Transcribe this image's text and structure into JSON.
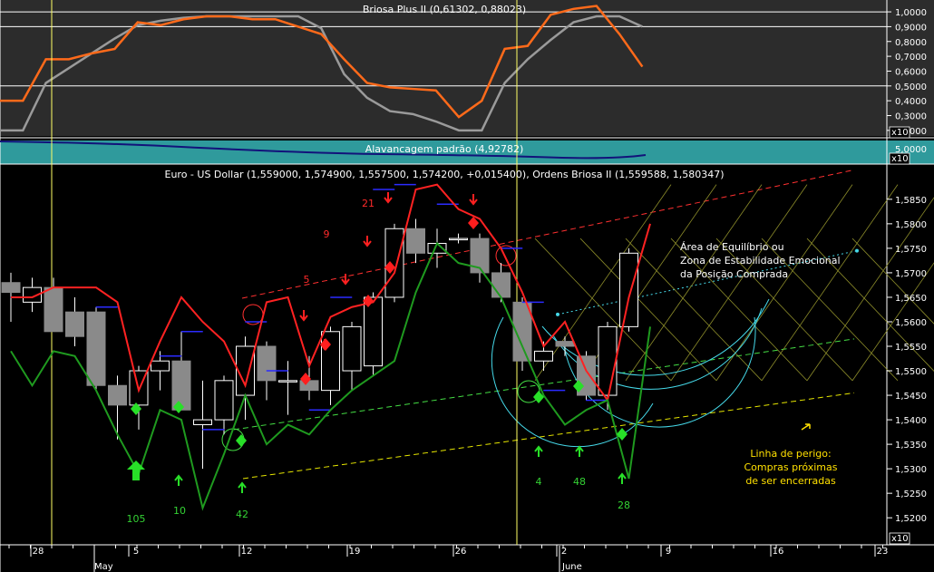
{
  "top_panel": {
    "title": "Briosa Plus II (0,61302, 0,88023)",
    "y_ticks": [
      "1,0000",
      "0,9000",
      "0,8000",
      "0,7000",
      "0,6000",
      "0,5000",
      "0,4000",
      "0,3000",
      "0,2000"
    ],
    "unit": "x10",
    "ref_lines": [
      0.5,
      0.9,
      1.0
    ],
    "series": [
      {
        "color": "#ff6a1a",
        "values": [
          0.4,
          0.4,
          0.68,
          0.68,
          0.72,
          0.75,
          0.93,
          0.91,
          0.95,
          0.97,
          0.97,
          0.95,
          0.95,
          0.9,
          0.85,
          0.68,
          0.52,
          0.49,
          0.48,
          0.47,
          0.29,
          0.4,
          0.75,
          0.77,
          0.98,
          1.02,
          1.04,
          0.85,
          0.63
        ]
      },
      {
        "color": "#9a9a9a",
        "values": [
          0.2,
          0.2,
          0.52,
          0.62,
          0.72,
          0.82,
          0.91,
          0.94,
          0.96,
          0.97,
          0.97,
          0.97,
          0.97,
          0.97,
          0.89,
          0.58,
          0.42,
          0.33,
          0.31,
          0.26,
          0.2,
          0.2,
          0.52,
          0.68,
          0.81,
          0.93,
          0.97,
          0.97,
          0.9
        ]
      }
    ]
  },
  "mid_panel": {
    "title": "Alavancagem padrão (4,92782)",
    "y_tick": "5,0000",
    "unit": "x10",
    "bg_color": "#2f9a9c"
  },
  "main_panel": {
    "title": "Euro - US Dollar (1,559000, 1,574900, 1,557500, 1,574200, +0,015400), Ordens Briosa II (1,559588, 1,580347)",
    "unit": "x10",
    "y_ticks": [
      "1,5850",
      "1,5800",
      "1,5750",
      "1,5700",
      "1,5650",
      "1,5600",
      "1,5550",
      "1,5500",
      "1,5450",
      "1,5400",
      "1,5350",
      "1,5300",
      "1,5250",
      "1,5200"
    ],
    "x_ticks": [
      "28",
      "5",
      "12",
      "19",
      "26",
      "2",
      "9",
      "16",
      "23"
    ],
    "month_labels": [
      "May",
      "June"
    ],
    "number_labels": [
      {
        "text": "21",
        "color": "#ff2a2a"
      },
      {
        "text": "9",
        "color": "#ff2a2a"
      },
      {
        "text": "5",
        "color": "#ff2a2a"
      },
      {
        "text": "105",
        "color": "#34d234"
      },
      {
        "text": "10",
        "color": "#34d234"
      },
      {
        "text": "42",
        "color": "#34d234"
      },
      {
        "text": "4",
        "color": "#34d234"
      },
      {
        "text": "48",
        "color": "#34d234"
      },
      {
        "text": "28",
        "color": "#34d234"
      }
    ],
    "annotations": {
      "equilibrium": [
        "Área de Equilíbrio ou",
        "Zona de Estabilidade Emocional",
        "da Posição Comprada"
      ],
      "danger": [
        "Linha de perigo:",
        "Compras próximas",
        "de ser encerradas"
      ]
    }
  },
  "chart_data": [
    {
      "type": "line",
      "title": "Briosa Plus II (0,61302, 0,88023)",
      "series": [
        {
          "values": [
            0.4,
            0.4,
            0.68,
            0.68,
            0.72,
            0.75,
            0.93,
            0.91,
            0.95,
            0.97,
            0.97,
            0.95,
            0.95,
            0.9,
            0.85,
            0.68,
            0.52,
            0.49,
            0.48,
            0.47,
            0.29,
            0.4,
            0.75,
            0.77,
            0.98,
            1.02,
            1.04,
            0.85,
            0.63
          ]
        },
        {
          "values": [
            0.2,
            0.2,
            0.52,
            0.62,
            0.72,
            0.82,
            0.91,
            0.94,
            0.96,
            0.97,
            0.97,
            0.97,
            0.97,
            0.97,
            0.89,
            0.58,
            0.42,
            0.33,
            0.31,
            0.26,
            0.2,
            0.2,
            0.52,
            0.68,
            0.81,
            0.93,
            0.97,
            0.97,
            0.9
          ]
        }
      ],
      "ylim": [
        0.15,
        1.08
      ],
      "grid": false
    },
    {
      "type": "candlestick",
      "title": "Euro - US Dollar (1,559000, 1,574900, 1,557500, 1,574200, +0,015400), Ordens Briosa II (1,559588, 1,580347)",
      "ylim": [
        1.518,
        1.592
      ],
      "x_ticks": [
        "28",
        "5",
        "12",
        "19",
        "26",
        "2",
        "9",
        "16",
        "23"
      ],
      "candles": [
        {
          "o": 1.568,
          "h": 1.57,
          "l": 1.56,
          "c": 1.566
        },
        {
          "o": 1.564,
          "h": 1.569,
          "l": 1.562,
          "c": 1.567
        },
        {
          "o": 1.567,
          "h": 1.569,
          "l": 1.558,
          "c": 1.558
        },
        {
          "o": 1.562,
          "h": 1.565,
          "l": 1.555,
          "c": 1.557
        },
        {
          "o": 1.562,
          "h": 1.563,
          "l": 1.546,
          "c": 1.547
        },
        {
          "o": 1.547,
          "h": 1.549,
          "l": 1.536,
          "c": 1.543
        },
        {
          "o": 1.543,
          "h": 1.551,
          "l": 1.538,
          "c": 1.55
        },
        {
          "o": 1.55,
          "h": 1.554,
          "l": 1.546,
          "c": 1.552
        },
        {
          "o": 1.552,
          "h": 1.558,
          "l": 1.544,
          "c": 1.542
        },
        {
          "o": 1.539,
          "h": 1.548,
          "l": 1.53,
          "c": 1.54
        },
        {
          "o": 1.54,
          "h": 1.549,
          "l": 1.537,
          "c": 1.548
        },
        {
          "o": 1.545,
          "h": 1.557,
          "l": 1.54,
          "c": 1.555
        },
        {
          "o": 1.555,
          "h": 1.556,
          "l": 1.544,
          "c": 1.548
        },
        {
          "o": 1.548,
          "h": 1.552,
          "l": 1.541,
          "c": 1.548
        },
        {
          "o": 1.548,
          "h": 1.553,
          "l": 1.544,
          "c": 1.546
        },
        {
          "o": 1.546,
          "h": 1.559,
          "l": 1.543,
          "c": 1.558
        },
        {
          "o": 1.55,
          "h": 1.56,
          "l": 1.546,
          "c": 1.559
        },
        {
          "o": 1.551,
          "h": 1.566,
          "l": 1.549,
          "c": 1.565
        },
        {
          "o": 1.565,
          "h": 1.58,
          "l": 1.564,
          "c": 1.579
        },
        {
          "o": 1.579,
          "h": 1.581,
          "l": 1.572,
          "c": 1.574
        },
        {
          "o": 1.574,
          "h": 1.579,
          "l": 1.571,
          "c": 1.576
        },
        {
          "o": 1.577,
          "h": 1.578,
          "l": 1.576,
          "c": 1.577
        },
        {
          "o": 1.577,
          "h": 1.578,
          "l": 1.568,
          "c": 1.57
        },
        {
          "o": 1.57,
          "h": 1.572,
          "l": 1.564,
          "c": 1.565
        },
        {
          "o": 1.564,
          "h": 1.565,
          "l": 1.55,
          "c": 1.552
        },
        {
          "o": 1.552,
          "h": 1.556,
          "l": 1.55,
          "c": 1.554
        },
        {
          "o": 1.556,
          "h": 1.557,
          "l": 1.553,
          "c": 1.555
        },
        {
          "o": 1.553,
          "h": 1.554,
          "l": 1.544,
          "c": 1.545
        },
        {
          "o": 1.545,
          "h": 1.56,
          "l": 1.542,
          "c": 1.559
        },
        {
          "o": 1.559,
          "h": 1.575,
          "l": 1.558,
          "c": 1.574
        }
      ],
      "series": [
        {
          "color": "#ff2222",
          "values": [
            1.565,
            1.565,
            1.567,
            1.567,
            1.567,
            1.564,
            1.546,
            1.556,
            1.565,
            1.56,
            1.556,
            1.547,
            1.564,
            1.565,
            1.551,
            1.561,
            1.563,
            1.564,
            1.57,
            1.587,
            1.588,
            1.583,
            1.581,
            1.575,
            1.566,
            1.555,
            1.56,
            1.55,
            1.544,
            1.565,
            1.58
          ]
        },
        {
          "color": "#1f9a1f",
          "values": [
            1.554,
            1.547,
            1.554,
            1.553,
            1.546,
            1.537,
            1.529,
            1.542,
            1.54,
            1.522,
            1.533,
            1.545,
            1.535,
            1.539,
            1.537,
            1.542,
            1.546,
            1.549,
            1.552,
            1.566,
            1.576,
            1.572,
            1.571,
            1.565,
            1.555,
            1.545,
            1.539,
            1.542,
            1.544,
            1.528,
            1.559
          ]
        }
      ]
    }
  ]
}
